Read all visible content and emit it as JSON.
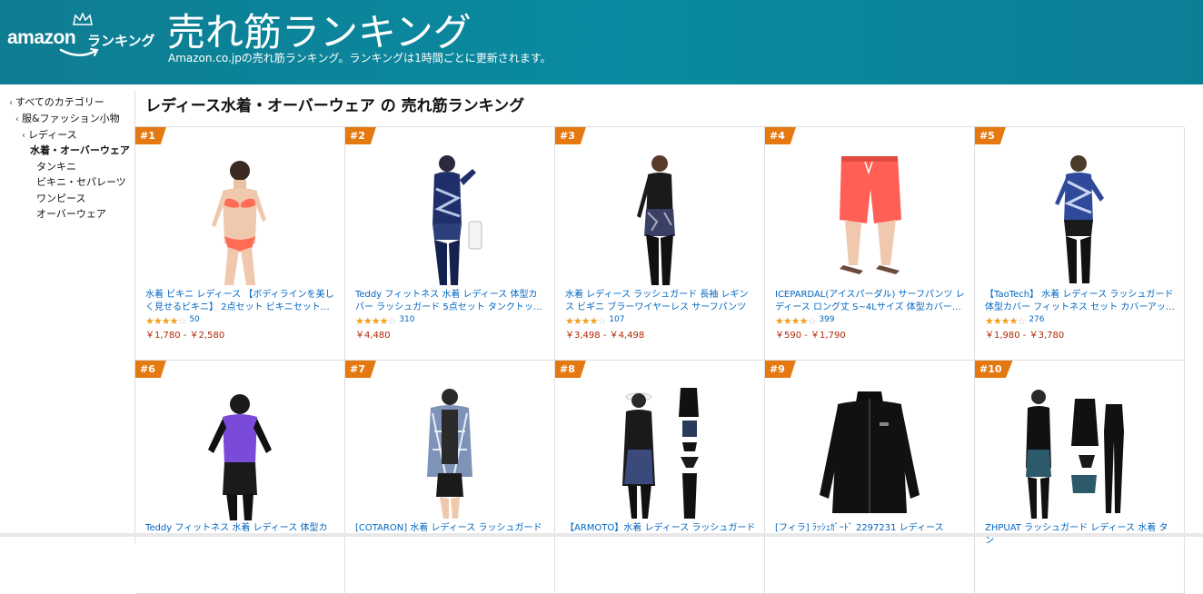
{
  "header": {
    "logo_word": "amazon",
    "logo_rank": "ランキング",
    "title": "売れ筋ランキング",
    "subtitle": "Amazon.co.jpの売れ筋ランキング。ランキングは1時間ごとに更新されます。"
  },
  "sidebar": {
    "items": [
      {
        "label": "すべてのカテゴリー",
        "chevron": true
      },
      {
        "label": "服&ファッション小物",
        "chevron": true
      },
      {
        "label": "レディース",
        "chevron": true
      },
      {
        "label": "水着・オーバーウェア",
        "current": true
      },
      {
        "label": "タンキニ"
      },
      {
        "label": "ビキニ・セパレーツ"
      },
      {
        "label": "ワンピース"
      },
      {
        "label": "オーバーウェア"
      }
    ]
  },
  "main": {
    "title": "レディース水着・オーバーウェア の 売れ筋ランキング"
  },
  "products": [
    {
      "rank": "#1",
      "title": "水着 ビキニ レディース 【ボディラインを美しく見せるビキニ】 2点セット ビキニセット…",
      "reviews": "50",
      "stars": 4,
      "price": "￥1,780 - ￥2,580"
    },
    {
      "rank": "#2",
      "title": "Teddy フィットネス 水着 レディース 体型カバー ラッシュガード 5点セット タンクトッ…",
      "reviews": "310",
      "stars": 4,
      "price": "￥4,480"
    },
    {
      "rank": "#3",
      "title": "水着 レディース ラッシュガード 長袖 レギンス ビギニ ブラーワイヤーレス サーフパンツ 体…",
      "reviews": "107",
      "stars": 4,
      "price": "￥3,498 - ￥4,498"
    },
    {
      "rank": "#4",
      "title": "ICEPARDAL(アイスパーダル) サーフパンツ レディース ロング丈 S~4Lサイズ 体型カバー…",
      "reviews": "399",
      "stars": 4,
      "price": "￥590 - ￥1,790"
    },
    {
      "rank": "#5",
      "title": "【TaoTech】 水着 レディース ラッシュガード 体型カバー フィットネス セット カバーアッ…",
      "reviews": "276",
      "stars": 4,
      "price": "￥1,980 - ￥3,780"
    },
    {
      "rank": "#6",
      "title": "Teddy フィットネス 水着 レディース 体型カ",
      "reviews": "",
      "stars": 0,
      "price": ""
    },
    {
      "rank": "#7",
      "title": "[COTARON] 水着 レディース ラッシュガード",
      "reviews": "",
      "stars": 0,
      "price": ""
    },
    {
      "rank": "#8",
      "title": "【ARMOTO】水着 レディース ラッシュガード",
      "reviews": "",
      "stars": 0,
      "price": ""
    },
    {
      "rank": "#9",
      "title": "[フィラ] ﾗｯｼｭｶﾞｰﾄﾞ 2297231 レディース",
      "reviews": "",
      "stars": 0,
      "price": ""
    },
    {
      "rank": "#10",
      "title": "ZHPUAT ラッシュガード レディース 水着 タン",
      "reviews": "",
      "stars": 0,
      "price": ""
    }
  ],
  "colors": {
    "header_bg": "#0b8aa0",
    "badge": "#e47911",
    "link": "#0066c0",
    "price": "#b12704",
    "star": "#f0a020"
  }
}
